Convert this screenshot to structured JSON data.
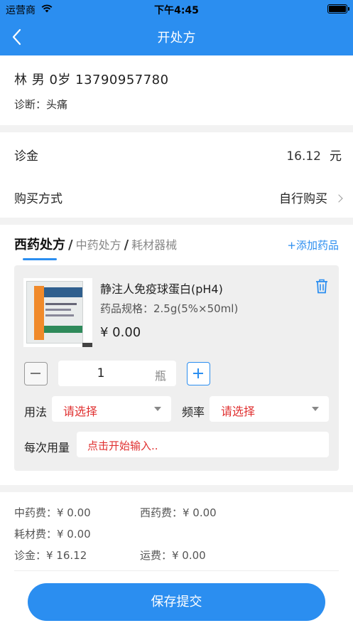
{
  "status_bar": {
    "carrier": "运营商",
    "time": "下午4:45"
  },
  "nav": {
    "title": "开处方"
  },
  "patient": {
    "info": "林   男 0岁 13790957780",
    "diagnosis": "诊断：头痛"
  },
  "fee": {
    "label": "诊金",
    "amount": "16.12",
    "unit": "元"
  },
  "purchase": {
    "label": "购买方式",
    "value": "自行购买"
  },
  "tabs": [
    {
      "label": "西药处方",
      "active": true
    },
    {
      "label": "中药处方",
      "active": false
    },
    {
      "label": "耗材器械",
      "active": false
    }
  ],
  "tab_separator": "/",
  "add_drug_label": "+添加药品",
  "drug": {
    "name": "静注人免疫球蛋白(pH4)",
    "spec": "药品规格：2.5g(5%×50ml)",
    "price": "¥ 0.00",
    "quantity": "1",
    "unit": "瓶"
  },
  "usage": {
    "label": "用法",
    "value": "请选择"
  },
  "frequency": {
    "label": "频率",
    "value": "请选择"
  },
  "dose": {
    "label": "每次用量",
    "placeholder": "点击开始输入.."
  },
  "summary": {
    "chinese_fee": "中药费：¥ 0.00",
    "western_fee": "西药费：¥ 0.00",
    "consumable_fee": "耗材费：¥ 0.00",
    "consult_fee": "诊金：¥ 16.12",
    "shipping_fee": "运费：¥ 0.00"
  },
  "submit_label": "保存提交",
  "colors": {
    "primary": "#2b8ef0",
    "placeholder_red": "#e03030"
  }
}
